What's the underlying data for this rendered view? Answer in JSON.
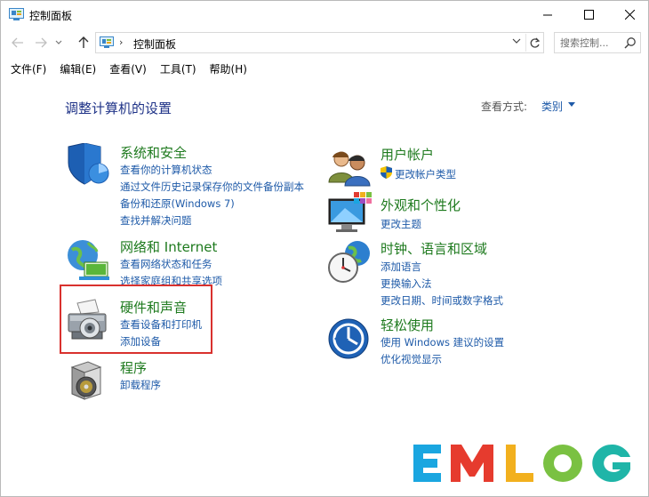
{
  "window": {
    "title": "控制面板",
    "controls": {
      "minimize": "minimize",
      "maximize": "maximize",
      "close": "close"
    }
  },
  "navigation": {
    "breadcrumb": "控制面板",
    "search_placeholder": "搜索控制..."
  },
  "menu": {
    "items": [
      "文件(F)",
      "编辑(E)",
      "查看(V)",
      "工具(T)",
      "帮助(H)"
    ]
  },
  "content": {
    "title": "调整计算机的设置",
    "view_by_label": "查看方式:",
    "view_by_value": "类别",
    "categories_left": [
      {
        "title": "系统和安全",
        "icon": "shield-icon",
        "links": [
          "查看你的计算机状态",
          "通过文件历史记录保存你的文件备份副本",
          "备份和还原(Windows 7)",
          "查找并解决问题"
        ]
      },
      {
        "title": "网络和 Internet",
        "icon": "network-icon",
        "links": [
          "查看网络状态和任务",
          "选择家庭组和共享选项"
        ]
      },
      {
        "title": "硬件和声音",
        "icon": "printer-icon",
        "links": [
          "查看设备和打印机",
          "添加设备"
        ]
      },
      {
        "title": "程序",
        "icon": "programs-icon",
        "links": [
          "卸载程序"
        ]
      }
    ],
    "categories_right": [
      {
        "title": "用户帐户",
        "icon": "users-icon",
        "links": [
          "更改帐户类型"
        ]
      },
      {
        "title": "外观和个性化",
        "icon": "monitor-icon",
        "links": [
          "更改主题"
        ]
      },
      {
        "title": "时钟、语言和区域",
        "icon": "clock-globe-icon",
        "links": [
          "添加语言",
          "更换输入法",
          "更改日期、时间或数字格式"
        ]
      },
      {
        "title": "轻松使用",
        "icon": "ease-of-access-icon",
        "links": [
          "使用 Windows 建议的设置",
          "优化视觉显示"
        ]
      }
    ]
  },
  "watermark": {
    "text": "EMLOG",
    "colors": [
      "#1aa6e0",
      "#e63b2e",
      "#f2b01e",
      "#7ac142",
      "#1fb5a8"
    ]
  }
}
